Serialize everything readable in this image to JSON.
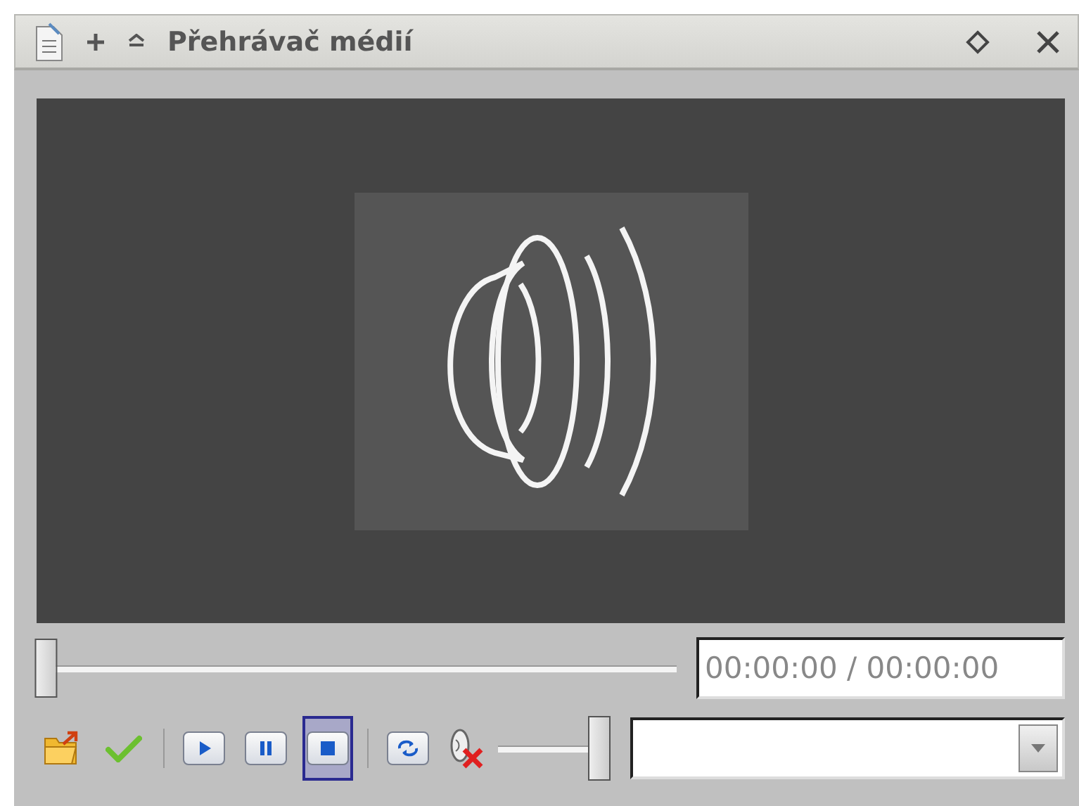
{
  "window": {
    "title": "Přehrávač médií"
  },
  "position_slider": {
    "level": 0
  },
  "time_display": {
    "value": "00:00:00 / 00:00:00"
  },
  "toolbar": [
    {
      "kind": "open",
      "selected": false
    },
    {
      "kind": "apply",
      "selected": false
    },
    {
      "kind": "separator"
    },
    {
      "kind": "play",
      "selected": false
    },
    {
      "kind": "pause",
      "selected": false
    },
    {
      "kind": "stop",
      "selected": true
    },
    {
      "kind": "separator"
    },
    {
      "kind": "repeat",
      "selected": false
    },
    {
      "kind": "mute",
      "muted": true
    }
  ],
  "volume_slider": {
    "level": 1
  }
}
